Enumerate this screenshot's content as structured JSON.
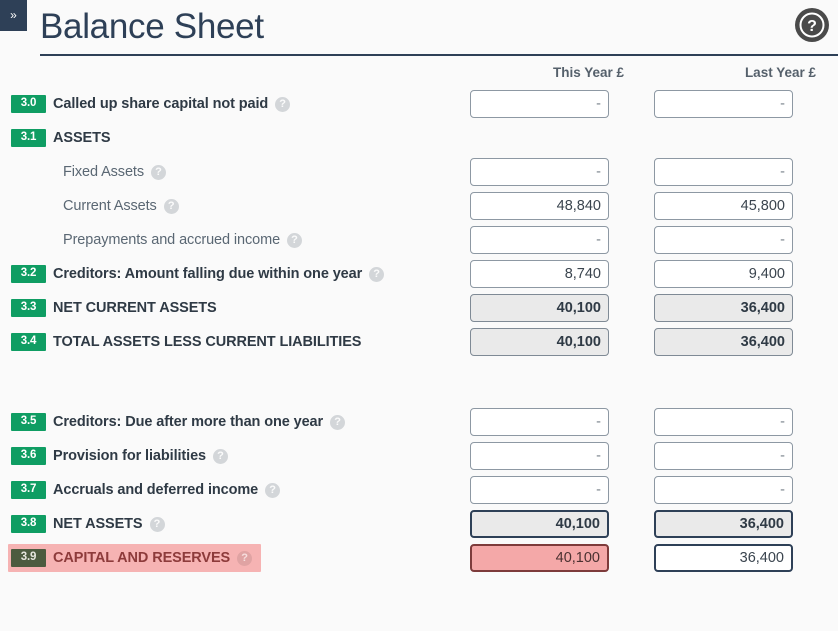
{
  "window": {
    "collapse_label": "»"
  },
  "header": {
    "title": "Balance Sheet",
    "help_icon": "help-circle-icon"
  },
  "columns": {
    "label": "",
    "this_year": "This Year £",
    "last_year": "Last Year £"
  },
  "icons": {
    "question": "?",
    "chevrons": "»"
  },
  "colors": {
    "brand_navy": "#2e4057",
    "badge_green": "#0f9d63",
    "badge_muted": "#4c5b3f",
    "error_pink": "#f6b3b3",
    "error_field": "#f4a8a8",
    "error_border": "#7d3b3b",
    "calc_grey": "#eaeaea",
    "page_bg": "#fafafa"
  },
  "rows": [
    {
      "code": "3.0",
      "label": "Called up share capital not paid",
      "has_help": true,
      "style": "normal",
      "indent": false,
      "this_year": "-",
      "last_year": "-",
      "this_year_style": "empty",
      "last_year_style": "empty"
    },
    {
      "code": "3.1",
      "label": "ASSETS",
      "has_help": false,
      "style": "section",
      "indent": false,
      "this_year": null,
      "last_year": null,
      "this_year_style": "none",
      "last_year_style": "none"
    },
    {
      "code": null,
      "label": "Fixed Assets",
      "has_help": true,
      "style": "sub",
      "indent": true,
      "this_year": "-",
      "last_year": "-",
      "this_year_style": "empty",
      "last_year_style": "empty"
    },
    {
      "code": null,
      "label": "Current Assets",
      "has_help": true,
      "style": "sub",
      "indent": true,
      "this_year": "48,840",
      "last_year": "45,800",
      "this_year_style": "value",
      "last_year_style": "value"
    },
    {
      "code": null,
      "label": "Prepayments and accrued income",
      "has_help": true,
      "style": "sub",
      "indent": true,
      "this_year": "-",
      "last_year": "-",
      "this_year_style": "empty",
      "last_year_style": "empty"
    },
    {
      "code": "3.2",
      "label": "Creditors: Amount falling due within one year",
      "has_help": true,
      "style": "normal",
      "indent": false,
      "this_year": "8,740",
      "last_year": "9,400",
      "this_year_style": "value",
      "last_year_style": "value"
    },
    {
      "code": "3.3",
      "label": "NET CURRENT ASSETS",
      "has_help": false,
      "style": "total",
      "indent": false,
      "this_year": "40,100",
      "last_year": "36,400",
      "this_year_style": "calc",
      "last_year_style": "calc"
    },
    {
      "code": "3.4",
      "label": "TOTAL ASSETS LESS CURRENT LIABILITIES",
      "has_help": false,
      "style": "total",
      "indent": false,
      "this_year": "40,100",
      "last_year": "36,400",
      "this_year_style": "calc",
      "last_year_style": "calc"
    },
    {
      "code": "3.5",
      "label": "Creditors: Due after more than one year",
      "has_help": true,
      "style": "normal",
      "indent": false,
      "this_year": "-",
      "last_year": "-",
      "this_year_style": "empty",
      "last_year_style": "empty"
    },
    {
      "code": "3.6",
      "label": "Provision for liabilities",
      "has_help": true,
      "style": "normal",
      "indent": false,
      "this_year": "-",
      "last_year": "-",
      "this_year_style": "empty",
      "last_year_style": "empty"
    },
    {
      "code": "3.7",
      "label": "Accruals and deferred income",
      "has_help": true,
      "style": "normal",
      "indent": false,
      "this_year": "-",
      "last_year": "-",
      "this_year_style": "empty",
      "last_year_style": "empty"
    },
    {
      "code": "3.8",
      "label": "NET ASSETS",
      "has_help": true,
      "style": "total",
      "indent": false,
      "this_year": "40,100",
      "last_year": "36,400",
      "this_year_style": "strong",
      "last_year_style": "strong"
    },
    {
      "code": "3.9",
      "label": "CAPITAL AND RESERVES",
      "has_help": true,
      "style": "error",
      "indent": false,
      "this_year": "40,100",
      "last_year": "36,400",
      "this_year_style": "error",
      "last_year_style": "plain-last"
    }
  ],
  "spacer_after_index": 7
}
